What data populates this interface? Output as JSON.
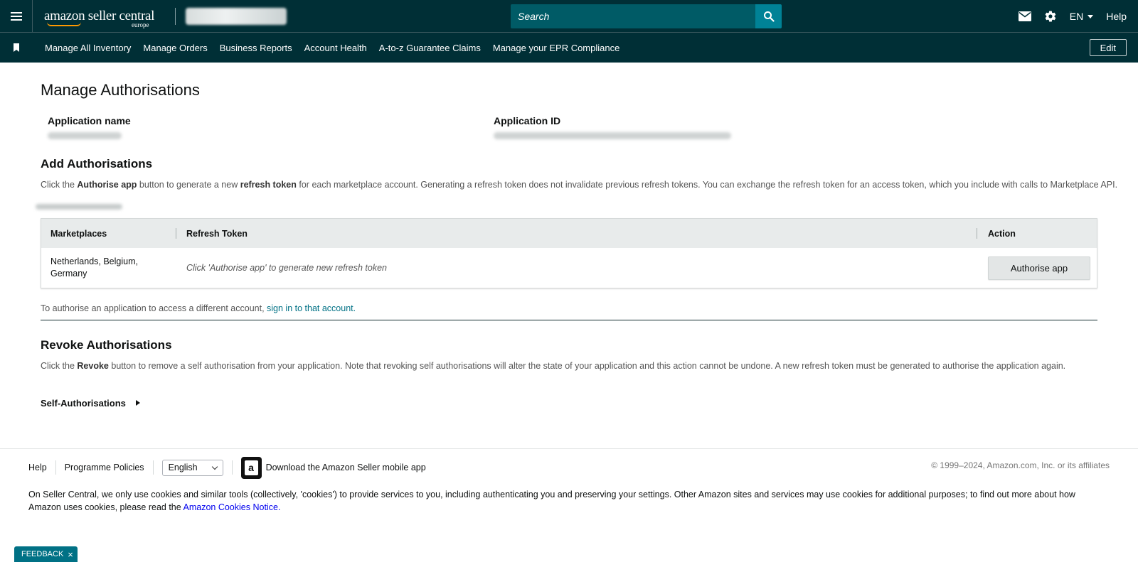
{
  "header": {
    "brand": "amazon seller central",
    "region": "europe",
    "search_placeholder": "Search",
    "language": "EN",
    "help": "Help"
  },
  "nav": {
    "items": [
      "Manage All Inventory",
      "Manage Orders",
      "Business Reports",
      "Account Health",
      "A-to-z Guarantee Claims",
      "Manage your EPR Compliance"
    ],
    "edit": "Edit"
  },
  "page": {
    "title": "Manage Authorisations",
    "app_name_label": "Application name",
    "app_id_label": "Application ID"
  },
  "add": {
    "heading": "Add Authorisations",
    "desc_1": "Click the ",
    "desc_b1": "Authorise app",
    "desc_2": " button to generate a new ",
    "desc_b2": "refresh token",
    "desc_3": " for each marketplace account. Generating a refresh token does not invalidate previous refresh tokens. You can exchange the refresh token for an access token, which you include with calls to Marketplace API.",
    "table": {
      "headers": [
        "Marketplaces",
        "Refresh Token",
        "Action"
      ],
      "rows": [
        {
          "marketplaces": "Netherlands, Belgium, Germany",
          "token": "Click 'Authorise app' to generate new refresh token",
          "action": "Authorise app"
        }
      ]
    },
    "switch_text": "To authorise an application to access a different account, ",
    "switch_link": "sign in to that account."
  },
  "revoke": {
    "heading": "Revoke Authorisations",
    "desc_1": "Click the ",
    "desc_b1": "Revoke",
    "desc_2": " button to remove a self authorisation from your application. Note that revoking self authorisations will alter the state of your application and this action cannot be undone. A new refresh token must be generated to authorise the application again.",
    "self_auth": "Self-Authorisations"
  },
  "footer": {
    "help": "Help",
    "policies": "Programme Policies",
    "language": "English",
    "app_icon_letter": "a",
    "app_download": "Download the Amazon Seller mobile app",
    "copyright": "© 1999–2024, Amazon.com, Inc. or its affiliates",
    "cookie_text": "On Seller Central, we only use cookies and similar tools (collectively, 'cookies') to provide services to you, including authenticating you and preserving your settings. Other Amazon sites and services may use cookies for additional purposes; to find out more about how Amazon uses cookies, please read the ",
    "cookie_link": "Amazon Cookies Notice."
  },
  "feedback": {
    "label": "FEEDBACK",
    "close": "×"
  },
  "colors": {
    "header_bg": "#002f36",
    "search_bg": "#005b66",
    "accent": "#008296",
    "link": "#007185"
  }
}
